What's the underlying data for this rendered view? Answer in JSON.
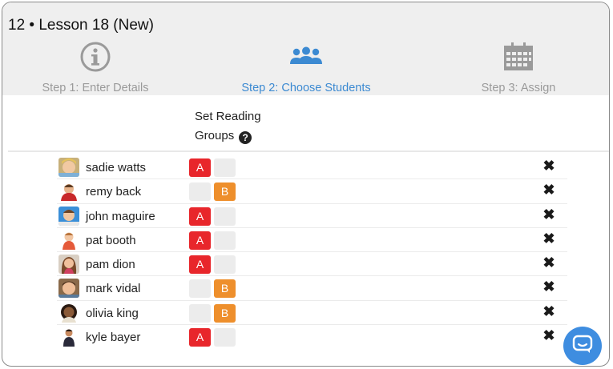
{
  "header": {
    "lesson_title": "12 • Lesson 18 (New)",
    "steps": [
      {
        "label": "Step 1: Enter Details",
        "icon": "info-icon",
        "active": false
      },
      {
        "label": "Step 2: Choose Students",
        "icon": "students-icon",
        "active": true
      },
      {
        "label": "Step 3: Assign",
        "icon": "calendar-icon",
        "active": false
      }
    ]
  },
  "reading_groups": {
    "heading_line1": "Set Reading",
    "heading_line2": "Groups",
    "help_icon": "?"
  },
  "students": [
    {
      "name": "sadie watts",
      "group": "A",
      "group_a_label": "A",
      "group_b_label": ""
    },
    {
      "name": "remy back",
      "group": "B",
      "group_a_label": "",
      "group_b_label": "B"
    },
    {
      "name": "john maguire",
      "group": "A",
      "group_a_label": "A",
      "group_b_label": ""
    },
    {
      "name": "pat booth",
      "group": "A",
      "group_a_label": "A",
      "group_b_label": ""
    },
    {
      "name": "pam dion",
      "group": "A",
      "group_a_label": "A",
      "group_b_label": ""
    },
    {
      "name": "mark vidal",
      "group": "B",
      "group_a_label": "",
      "group_b_label": "B"
    },
    {
      "name": "olivia king",
      "group": "B",
      "group_a_label": "",
      "group_b_label": "B"
    },
    {
      "name": "kyle bayer",
      "group": "A",
      "group_a_label": "A",
      "group_b_label": ""
    }
  ],
  "remove_icon": "✖",
  "colors": {
    "group_a": "#e8262b",
    "group_b": "#ee8f2c",
    "active_step": "#3c8ad2",
    "inactive_step": "#9a9a9a",
    "chat_button": "#3e8de0"
  },
  "chat_button": {
    "icon": "chat-icon"
  }
}
